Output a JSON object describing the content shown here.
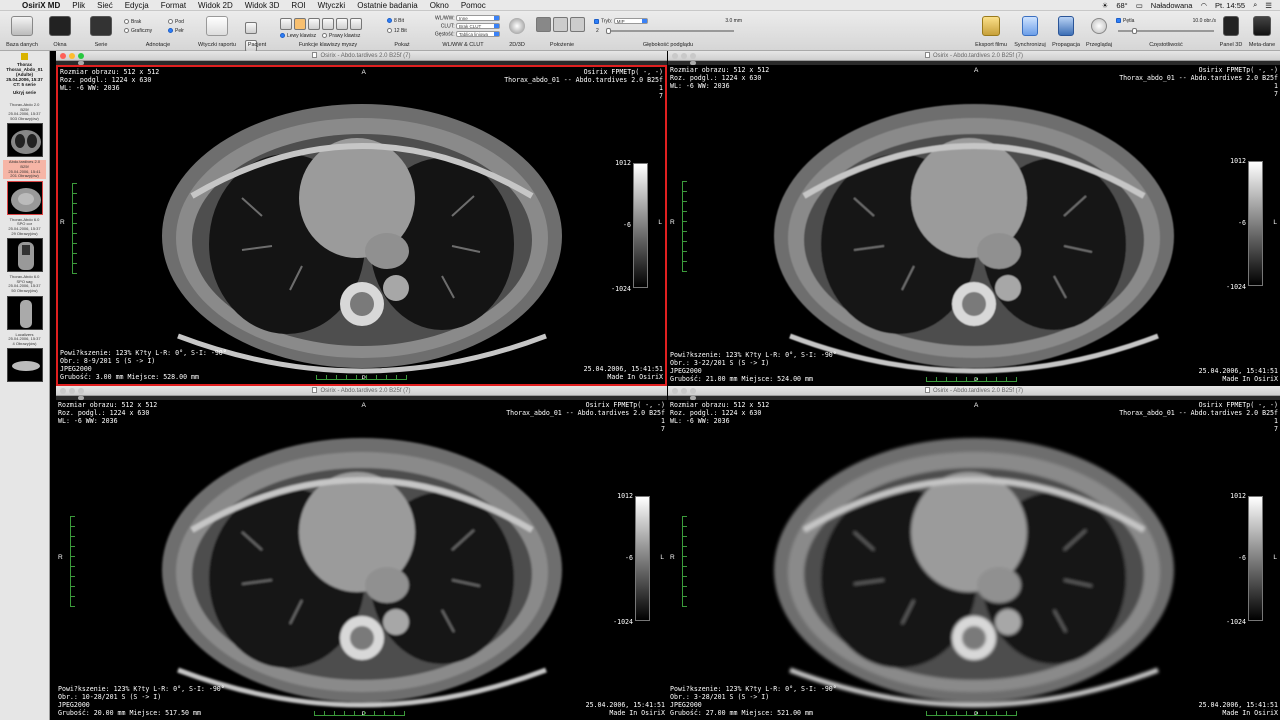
{
  "menubar": {
    "app": "OsiriX MD",
    "items": [
      "Plik",
      "Sieć",
      "Edycja",
      "Format",
      "Widok 2D",
      "Widok 3D",
      "ROI",
      "Wtyczki",
      "Ostatnie badania",
      "Okno",
      "Pomoc"
    ],
    "temperature": "68°",
    "battery": "Naładowana",
    "clock": "Pt. 14:55"
  },
  "toolbar": {
    "labels": [
      "Baza danych",
      "Okna",
      "Serie",
      "Adnotacje",
      "Wtyczki raportu",
      "Pacjent",
      "Funkcje klawiszy myszy",
      "Pokaż",
      "WL/WW & CLUT",
      "2D/3D",
      "Położenie",
      "Głębokość podglądu",
      "Eksport filmu",
      "Synchronizuj",
      "Propagacja",
      "Przeglądaj",
      "Częstotliwość",
      "Panel 3D",
      "Meta-dane"
    ],
    "annot": [
      "Brak",
      "Pod",
      "Graficzny",
      "Pełr"
    ],
    "mouse": [
      "Lewy klawisz",
      "Prawy klawisz"
    ],
    "bits": [
      "8 Bit",
      "12 Bit"
    ],
    "wl_labels": [
      "WL/WW:",
      "CLUT:",
      "Gęstość:"
    ],
    "wl_values": [
      "Inne",
      "Brak CLUT",
      "Tablica liniowa"
    ],
    "mode_label": "Tryb:",
    "mode_value": "MIP",
    "mode_count": "2",
    "thickness": "3.0 mm",
    "loop_label": "Pętla",
    "fps": "10.0 obr./s"
  },
  "sidebar": {
    "study": [
      "Thorax",
      "Thorax_Abdo_01",
      "(Adulte)",
      "25.04.2006, 15:37",
      "CT: 5 serie"
    ],
    "hide": "Ukryj serie",
    "series": [
      {
        "lines": [
          "Thorax-Abdo 2.0",
          "B25f",
          "25.04.2006, 15:37",
          "503 Obrazy(ów)"
        ],
        "selected": false
      },
      {
        "lines": [
          "Abdo.tardives 2.0",
          "B25f",
          "25.04.2006, 15:41",
          "201 Obrazy(ów)"
        ],
        "selected": true
      },
      {
        "lines": [
          "Thorax-Abdo 6.0",
          "SPO cor",
          "25.04.2006, 15:37",
          "29 Obrazy(ów)"
        ],
        "selected": false
      },
      {
        "lines": [
          "Thorax-Abdo 6.0",
          "SPO sag",
          "25.04.2006, 15:37",
          "50 Obrazy(ów)"
        ],
        "selected": false
      },
      {
        "lines": [
          "Localizers",
          "25.04.2006, 15:37",
          "4 Obrazy(ów)"
        ],
        "selected": false
      }
    ]
  },
  "viewer_title": "Osirix - Abdo.tardives 2.0 B25f (7)",
  "viewers": [
    {
      "size": "Rozmiar obrazu: 512 x 512",
      "view": "Roz. podgl.: 1224 x 630",
      "wlww": "WL: -6 WW: 2036",
      "tr1": "Osirix FPMETp( -, -)",
      "tr2": "Thorax_abdo_01 -- Abdo.tardives 2.0 B25f",
      "tr3": "1",
      "tr4": "7",
      "zoom": "Powi?kszenie: 123% K?ty L-R: 0°, S-I: -90°",
      "obr": "Obr.: 8-9/201  S (S -> I)",
      "codec": "JPEG2000",
      "thick": "Grubość: 3.00 mm Miejsce: 528.00 mm",
      "date": "25.04.2006, 15:41:51",
      "made": "Made In OsiriX",
      "top": "A",
      "left": "R",
      "right": "L",
      "bottom": "P",
      "wl_max": "1012",
      "wl_mid": "-6",
      "wl_min": "-1024"
    },
    {
      "size": "Rozmiar obrazu: 512 x 512",
      "view": "Roz. podgl.: 1224 x 630",
      "wlww": "WL: -6 WW: 2036",
      "tr1": "Osirix FPMETp( -, -)",
      "tr2": "Thorax_abdo_01 -- Abdo.tardives 2.0 B25f",
      "tr3": "1",
      "tr4": "7",
      "zoom": "Powi?kszenie: 123% K?ty L-R: 0°, S-I: -90°",
      "obr": "Obr.: 3-22/201  S (S -> I)",
      "codec": "JPEG2000",
      "thick": "Grubość: 21.00 mm Miejsce: 524.00 mm",
      "date": "25.04.2006, 15:41:51",
      "made": "Made In OsiriX",
      "top": "A",
      "left": "R",
      "right": "L",
      "bottom": "P",
      "wl_max": "1012",
      "wl_mid": "-6",
      "wl_min": "-1024"
    },
    {
      "size": "Rozmiar obrazu: 512 x 512",
      "view": "Roz. podgl.: 1224 x 630",
      "wlww": "WL: -6 WW: 2036",
      "tr1": "Osirix FPMETp( -, -)",
      "tr2": "Thorax_abdo_01 -- Abdo.tardives 2.0 B25f",
      "tr3": "1",
      "tr4": "7",
      "zoom": "Powi?kszenie: 123% K?ty L-R: 0°, S-I: -90°",
      "obr": "Obr.: 10-28/201  S (S -> I)",
      "codec": "JPEG2000",
      "thick": "Grubość: 20.00 mm Miejsce: 517.50 mm",
      "date": "25.04.2006, 15:41:51",
      "made": "Made In OsiriX",
      "top": "A",
      "left": "R",
      "right": "L",
      "bottom": "P",
      "wl_max": "1012",
      "wl_mid": "-6",
      "wl_min": "-1024"
    },
    {
      "size": "Rozmiar obrazu: 512 x 512",
      "view": "Roz. podgl.: 1224 x 630",
      "wlww": "WL: -6 WW: 2036",
      "tr1": "Osirix FPMETp( -, -)",
      "tr2": "Thorax_abdo_01 -- Abdo.tardives 2.0 B25f",
      "tr3": "1",
      "tr4": "7",
      "zoom": "Powi?kszenie: 123% K?ty L-R: 0°, S-I: -90°",
      "obr": "Obr.: 3-28/201  S (S -> I)",
      "codec": "JPEG2000",
      "thick": "Grubość: 27.00 mm Miejsce: 521.00 mm",
      "date": "25.04.2006, 15:41:51",
      "made": "Made In OsiriX",
      "top": "A",
      "left": "R",
      "right": "L",
      "bottom": "P",
      "wl_max": "1012",
      "wl_mid": "-6",
      "wl_min": "-1024"
    }
  ]
}
